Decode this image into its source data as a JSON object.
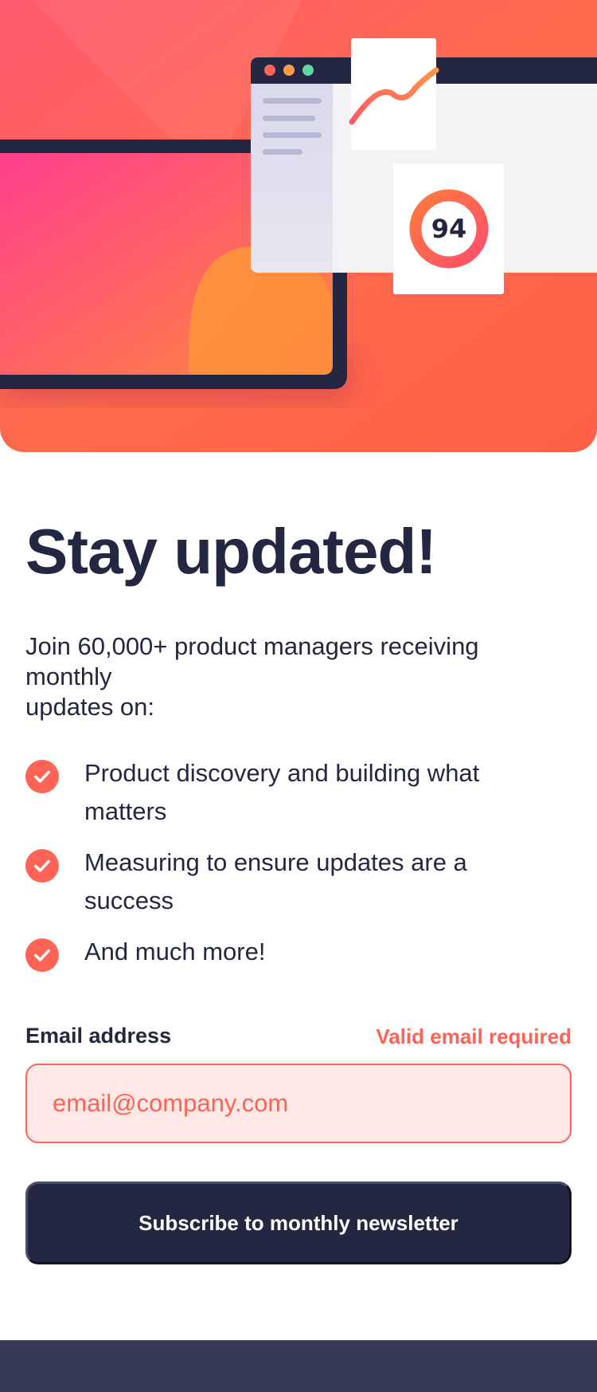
{
  "hero": {
    "score_value": "94",
    "colors": {
      "gradient_start": "#ff527b",
      "gradient_end": "#ff6a3a",
      "dark": "#242742",
      "accent": "#ff6257"
    },
    "illustration_icons": [
      "laptop-icon",
      "browser-window-icon",
      "line-chart-icon",
      "score-ring-icon"
    ]
  },
  "main": {
    "title": "Stay updated!",
    "lead_line1": "Join 60,000+ product managers receiving monthly",
    "lead_line2": "updates on:",
    "features": [
      {
        "text": "Product discovery and building what matters",
        "icon": "check-icon"
      },
      {
        "text": "Measuring to ensure updates are a success",
        "icon": "check-icon"
      },
      {
        "text": "And much more!",
        "icon": "check-icon"
      }
    ]
  },
  "form": {
    "email_label": "Email address",
    "error_message": "Valid email required",
    "email_value": "",
    "email_placeholder": "email@company.com",
    "submit_label": "Subscribe to monthly newsletter"
  },
  "theme": {
    "accent": "#ff6257",
    "dark_navy": "#242742",
    "charcoal": "#373a55",
    "error_bg": "#ffe8e6"
  }
}
